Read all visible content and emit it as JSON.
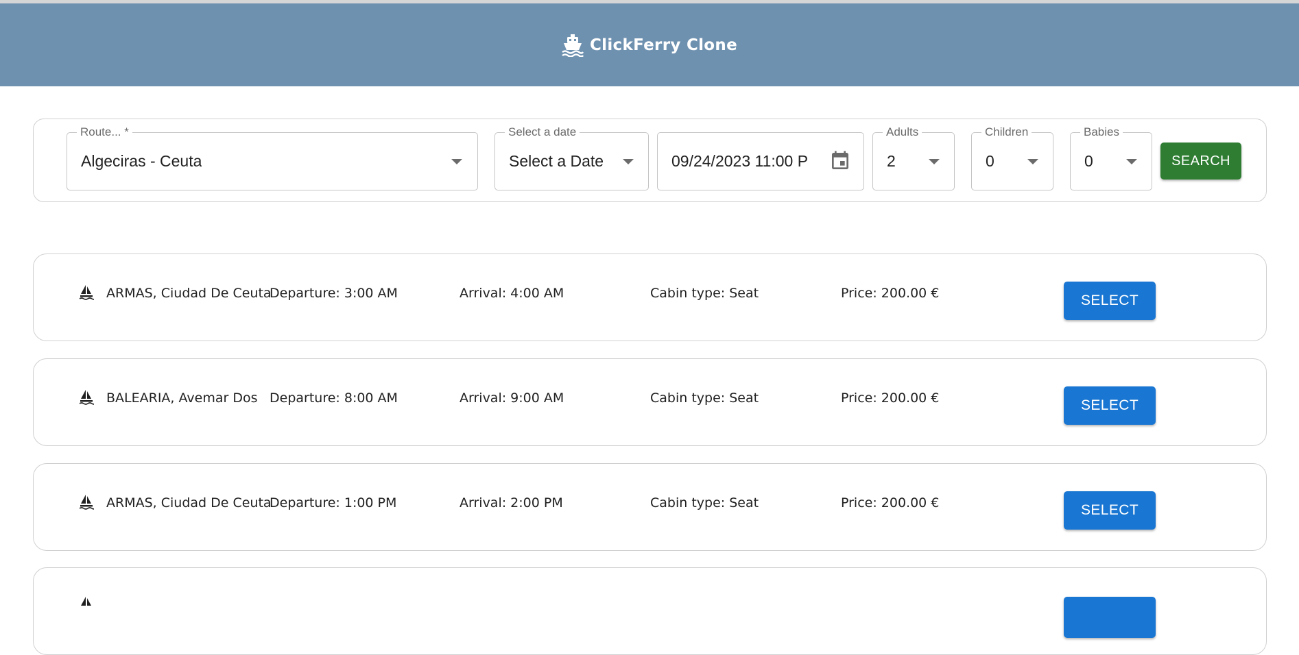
{
  "header": {
    "title": "ClickFerry Clone",
    "icon": "ship-icon"
  },
  "search": {
    "route": {
      "label": "Route... *",
      "value": "Algeciras - Ceuta"
    },
    "date_select": {
      "label": "Select a date",
      "value": "Select a Date"
    },
    "datetime": {
      "value": "09/24/2023 11:00 P"
    },
    "adults": {
      "label": "Adults",
      "value": "2"
    },
    "children": {
      "label": "Children",
      "value": "0"
    },
    "babies": {
      "label": "Babies",
      "value": "0"
    },
    "search_label": "SEARCH"
  },
  "results": [
    {
      "operator": "ARMAS, Ciudad De Ceuta",
      "departure": "Departure: 3:00 AM",
      "arrival": "Arrival: 4:00 AM",
      "cabin": "Cabin type: Seat",
      "price": "Price: 200.00 €",
      "select_label": "SELECT"
    },
    {
      "operator": "BALEARIA, Avemar Dos",
      "departure": "Departure: 8:00 AM",
      "arrival": "Arrival: 9:00 AM",
      "cabin": "Cabin type: Seat",
      "price": "Price: 200.00 €",
      "select_label": "SELECT"
    },
    {
      "operator": "ARMAS, Ciudad De Ceuta",
      "departure": "Departure: 1:00 PM",
      "arrival": "Arrival: 2:00 PM",
      "cabin": "Cabin type: Seat",
      "price": "Price: 200.00 €",
      "select_label": "SELECT"
    }
  ],
  "colors": {
    "header_bg": "#6f91b0",
    "search_button": "#2e7d32",
    "select_button": "#1976d2"
  }
}
